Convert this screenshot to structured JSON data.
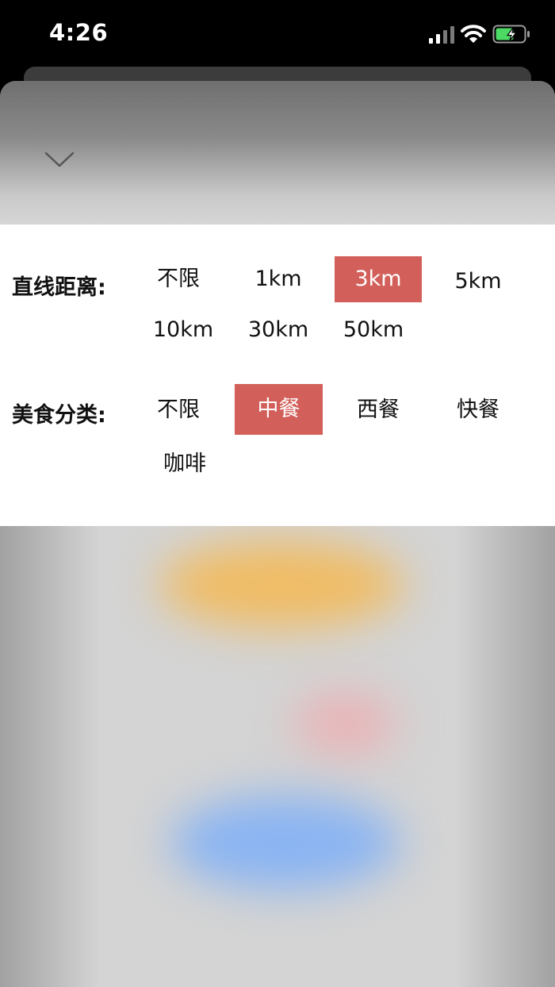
{
  "status_bar": {
    "time": "4:26"
  },
  "filters": {
    "distance": {
      "label": "直线距离:",
      "options": [
        "不限",
        "1km",
        "3km",
        "5km",
        "10km",
        "30km",
        "50km"
      ],
      "selected": "3km"
    },
    "cuisine": {
      "label": "美食分类:",
      "options": [
        "不限",
        "中餐",
        "西餐",
        "快餐",
        "咖啡"
      ],
      "selected": "中餐"
    }
  },
  "colors": {
    "accent": "#d25f59",
    "panel_background": "#ffffff",
    "status_bar_background": "#000000"
  },
  "icons": {
    "collapse": "chevron-down-icon",
    "signal": "signal-icon",
    "wifi": "wifi-icon",
    "battery": "battery-icon"
  }
}
